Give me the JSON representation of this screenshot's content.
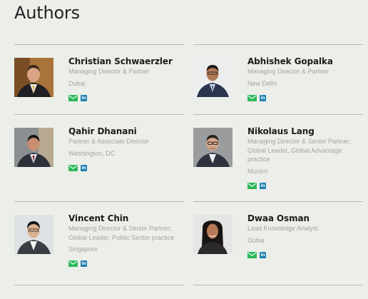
{
  "page": {
    "title": "Authors"
  },
  "colors": {
    "background": "#ecefe9",
    "muted_text": "#a3a6a0",
    "email_green": "#2db85a",
    "linkedin_blue": "#1d7fb0"
  },
  "icons": {
    "email": "email-icon",
    "linkedin": "linkedin-icon",
    "linkedin_glyph": "in"
  },
  "authors": [
    {
      "name": "Christian Schwaerzler",
      "role": "Managing Director & Partner",
      "location": "Dubai"
    },
    {
      "name": "Abhishek Gopalka",
      "role": "Managing Director & Partner",
      "location": "New Delhi"
    },
    {
      "name": "Qahir Dhanani",
      "role": "Partner & Associate Director",
      "location": "Washington, DC"
    },
    {
      "name": "Nikolaus Lang",
      "role": "Managing Director & Senior Partner; Global Leader, Global Advantage practice",
      "location": "Munich"
    },
    {
      "name": "Vincent Chin",
      "role": "Managing Director & Senior Partner; Global Leader, Public Sector practice",
      "location": "Singapore"
    },
    {
      "name": "Dwaa Osman",
      "role": "Lead Knowledge Analyst",
      "location": "Dubai"
    }
  ]
}
